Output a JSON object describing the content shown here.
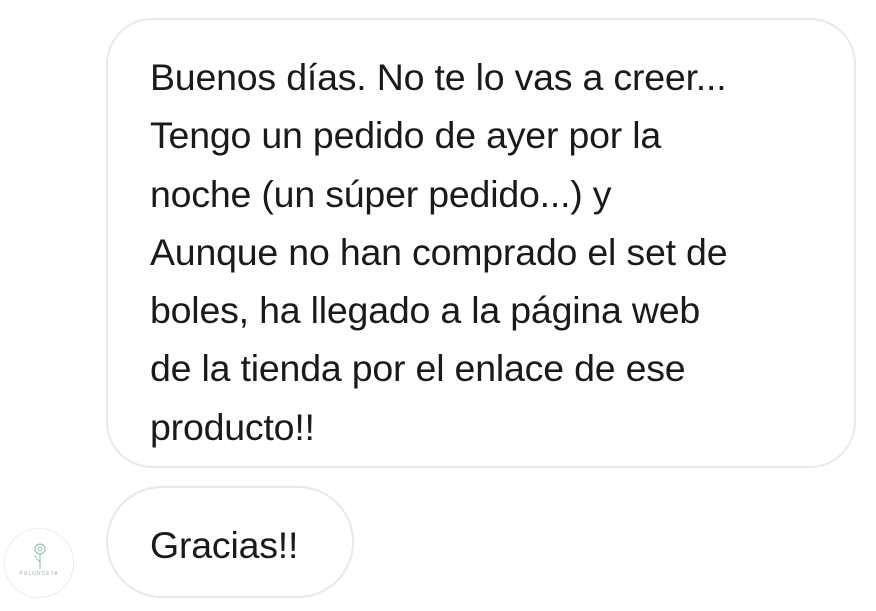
{
  "messages": [
    {
      "sender": "other",
      "lines": [
        "Buenos días. No te lo vas a creer...",
        "Tengo un pedido de ayer por la",
        "noche (un súper pedido...) y",
        "Aunque no han comprado el set de",
        "boles, ha llegado a la página web",
        "de la tienda por el enlace de ese",
        "producto!!"
      ]
    },
    {
      "sender": "other",
      "lines": [
        "Gracias!!"
      ]
    }
  ],
  "avatar": {
    "logo_text": "PULORCETA",
    "icon": "dandelion-logo-icon",
    "accent_color": "#8ab3ad"
  },
  "colors": {
    "bubble_border": "#e8e8e8",
    "bubble_background": "#ffffff",
    "text": "#1a1a1a"
  }
}
